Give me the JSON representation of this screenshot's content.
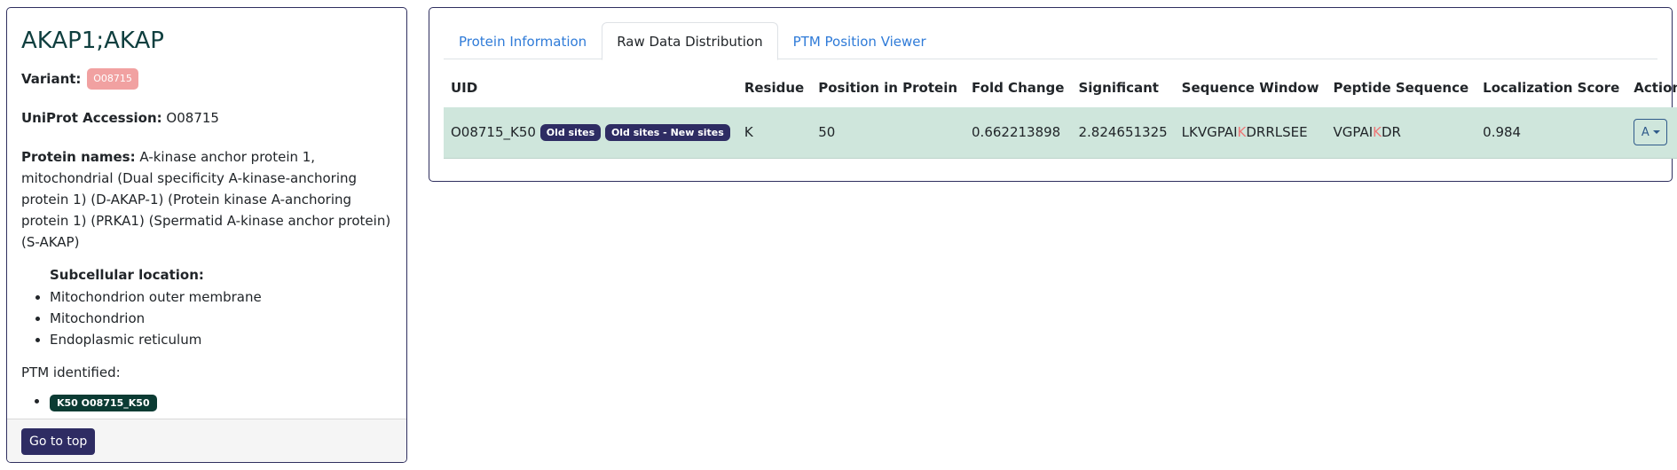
{
  "left": {
    "title": "AKAP1;AKAP",
    "variant_label": "Variant:",
    "variant_value": "O08715",
    "accession_label": "UniProt Accession:",
    "accession_value": "O08715",
    "names_label": "Protein names:",
    "names_value": "A-kinase anchor protein 1, mitochondrial (Dual specificity A-kinase-anchoring protein 1) (D-AKAP-1) (Protein kinase A-anchoring protein 1) (PRKA1) (Spermatid A-kinase anchor protein) (S-AKAP)",
    "subcellular_label": "Subcellular location:",
    "locations": [
      "Mitochondrion outer membrane",
      "Mitochondrion",
      "Endoplasmic reticulum"
    ],
    "ptm_label": "PTM identified:",
    "ptm_badges": [
      "K50 O08715_K50"
    ],
    "go_top_label": "Go to top"
  },
  "tabs": [
    {
      "label": "Protein Information",
      "active": false
    },
    {
      "label": "Raw Data Distribution",
      "active": true
    },
    {
      "label": "PTM Position Viewer",
      "active": false
    }
  ],
  "table": {
    "headers": [
      "UID",
      "Residue",
      "Position in Protein",
      "Fold Change",
      "Significant",
      "Sequence Window",
      "Peptide Sequence",
      "Localization Score",
      "Actions"
    ],
    "rows": [
      {
        "uid": "O08715_K50",
        "badges": [
          "Old sites",
          "Old sites - New sites"
        ],
        "residue": "K",
        "position": "50",
        "fold_change": "0.662213898",
        "significant": "2.824651325",
        "sequence_window": {
          "pre": "LKVGPAI",
          "site": "K",
          "post": "DRRLSEE"
        },
        "peptide_sequence": {
          "pre": "VGPAI",
          "site": "K",
          "post": "DR"
        },
        "localization_score": "0.984",
        "action_label": "A"
      }
    ]
  },
  "colors": {
    "highlight_residue": "#ee7777",
    "row_background": "#cfe6dc",
    "badge_dark": "#2e2c63",
    "ptm_badge": "#0b3b33",
    "variant_badge": "#f1a1a1",
    "link": "#2f7bd8"
  }
}
